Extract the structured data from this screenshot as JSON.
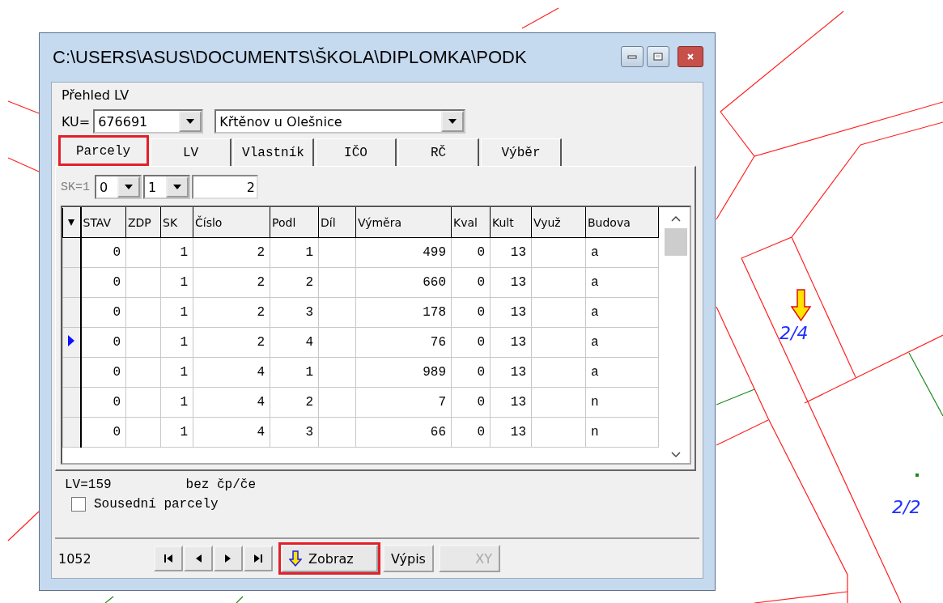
{
  "window": {
    "title": "C:\\USERS\\ASUS\\DOCUMENTS\\ŠKOLA\\DIPLOMKA\\PODK"
  },
  "heading": "Přehled LV",
  "ku": {
    "label": "KU=",
    "code": "676691",
    "name": "Křtěnov u Olešnice"
  },
  "tabs": [
    {
      "label": "Parcely",
      "selected": true,
      "highlighted": true
    },
    {
      "label": "LV",
      "selected": false,
      "highlighted": false
    },
    {
      "label": "Vlastník",
      "selected": false,
      "highlighted": false
    },
    {
      "label": "IČO",
      "selected": false,
      "highlighted": false
    },
    {
      "label": "RČ",
      "selected": false,
      "highlighted": false
    },
    {
      "label": "Výběr",
      "selected": false,
      "highlighted": false
    }
  ],
  "filter": {
    "label": "SK=1",
    "combo_1": "0",
    "combo_2": "1",
    "value": "2"
  },
  "table": {
    "columns": [
      "STAV",
      "ZDP",
      "SK",
      "Číslo",
      "Podl",
      "Díl",
      "Výměra",
      "Kval",
      "Kult",
      "Využ",
      "Budova"
    ],
    "rows": [
      {
        "current": false,
        "cells": [
          "0",
          null,
          "1",
          "2",
          "1",
          null,
          "499",
          "0",
          "13",
          null,
          "a"
        ]
      },
      {
        "current": false,
        "cells": [
          "0",
          null,
          "1",
          "2",
          "2",
          null,
          "660",
          "0",
          "13",
          null,
          "a"
        ]
      },
      {
        "current": false,
        "cells": [
          "0",
          null,
          "1",
          "2",
          "3",
          null,
          "178",
          "0",
          "13",
          null,
          "a"
        ]
      },
      {
        "current": true,
        "cells": [
          "0",
          null,
          "1",
          "2",
          "4",
          null,
          "76",
          "0",
          "13",
          null,
          "a"
        ]
      },
      {
        "current": false,
        "cells": [
          "0",
          null,
          "1",
          "4",
          "1",
          null,
          "989",
          "0",
          "13",
          null,
          "a"
        ]
      },
      {
        "current": false,
        "cells": [
          "0",
          null,
          "1",
          "4",
          "2",
          null,
          "7",
          "0",
          "13",
          null,
          "n"
        ]
      },
      {
        "current": false,
        "cells": [
          "0",
          null,
          "1",
          "4",
          "3",
          null,
          "66",
          "0",
          "13",
          null,
          "n"
        ]
      }
    ]
  },
  "info": {
    "lv": "LV=159",
    "note": "bez čp/če"
  },
  "neighbors": {
    "label": "Sousední parcely",
    "checked": false
  },
  "footer": {
    "count": "1052",
    "nav": [
      {
        "kind": "first"
      },
      {
        "kind": "prev"
      },
      {
        "kind": "next"
      },
      {
        "kind": "last"
      }
    ],
    "buttons": [
      {
        "label": "Zobraz",
        "kind": "show",
        "highlighted": true,
        "disabled": false
      },
      {
        "label": "Výpis",
        "kind": "plain",
        "highlighted": false,
        "disabled": false
      },
      {
        "label": "XY",
        "kind": "plain",
        "highlighted": false,
        "disabled": true
      }
    ]
  },
  "map": {
    "labels": [
      "2/4",
      "2/2"
    ]
  }
}
